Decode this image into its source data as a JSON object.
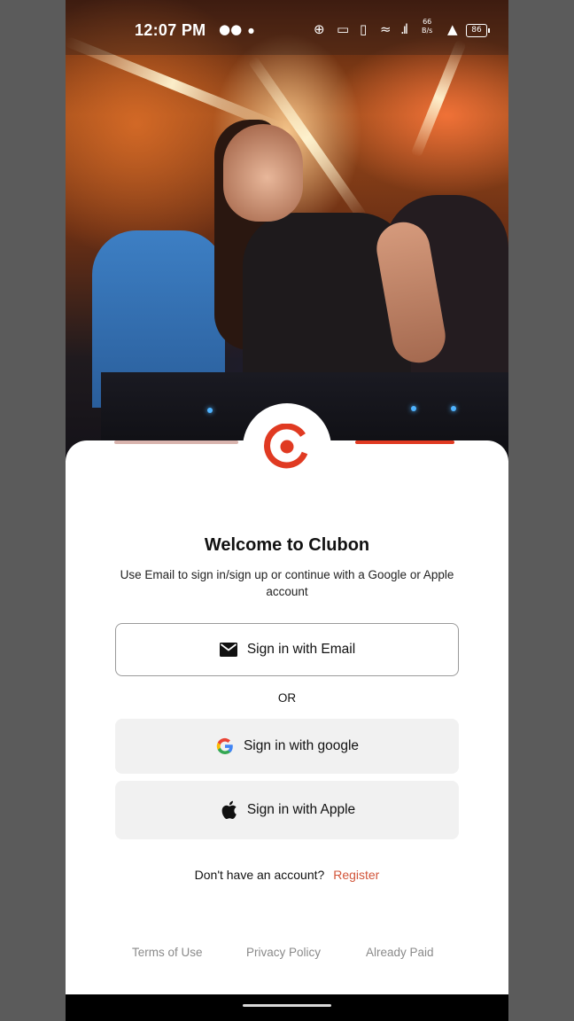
{
  "status_bar": {
    "time": "12:07 PM",
    "net_speed_value": "66",
    "net_speed_unit": "B/s",
    "battery": "86"
  },
  "sheet": {
    "title": "Welcome to Clubon",
    "subtitle": "Use Email to sign in/sign up or continue with a Google or Apple account",
    "email_button_label": "Sign in with Email",
    "or_label": "OR",
    "google_button_label": "Sign in with google",
    "apple_button_label": "Sign in with Apple",
    "register_prompt": "Don't have an account?",
    "register_link": "Register"
  },
  "footer": {
    "terms": "Terms of Use",
    "privacy": "Privacy Policy",
    "already_paid": "Already Paid"
  },
  "colors": {
    "brand_red": "#e03a22",
    "link_orange": "#d2553a",
    "button_gray": "#f1f1f1"
  },
  "icons": {
    "logo": "clubon-logo-icon",
    "email": "mail-icon",
    "google": "google-icon",
    "apple": "apple-icon"
  }
}
